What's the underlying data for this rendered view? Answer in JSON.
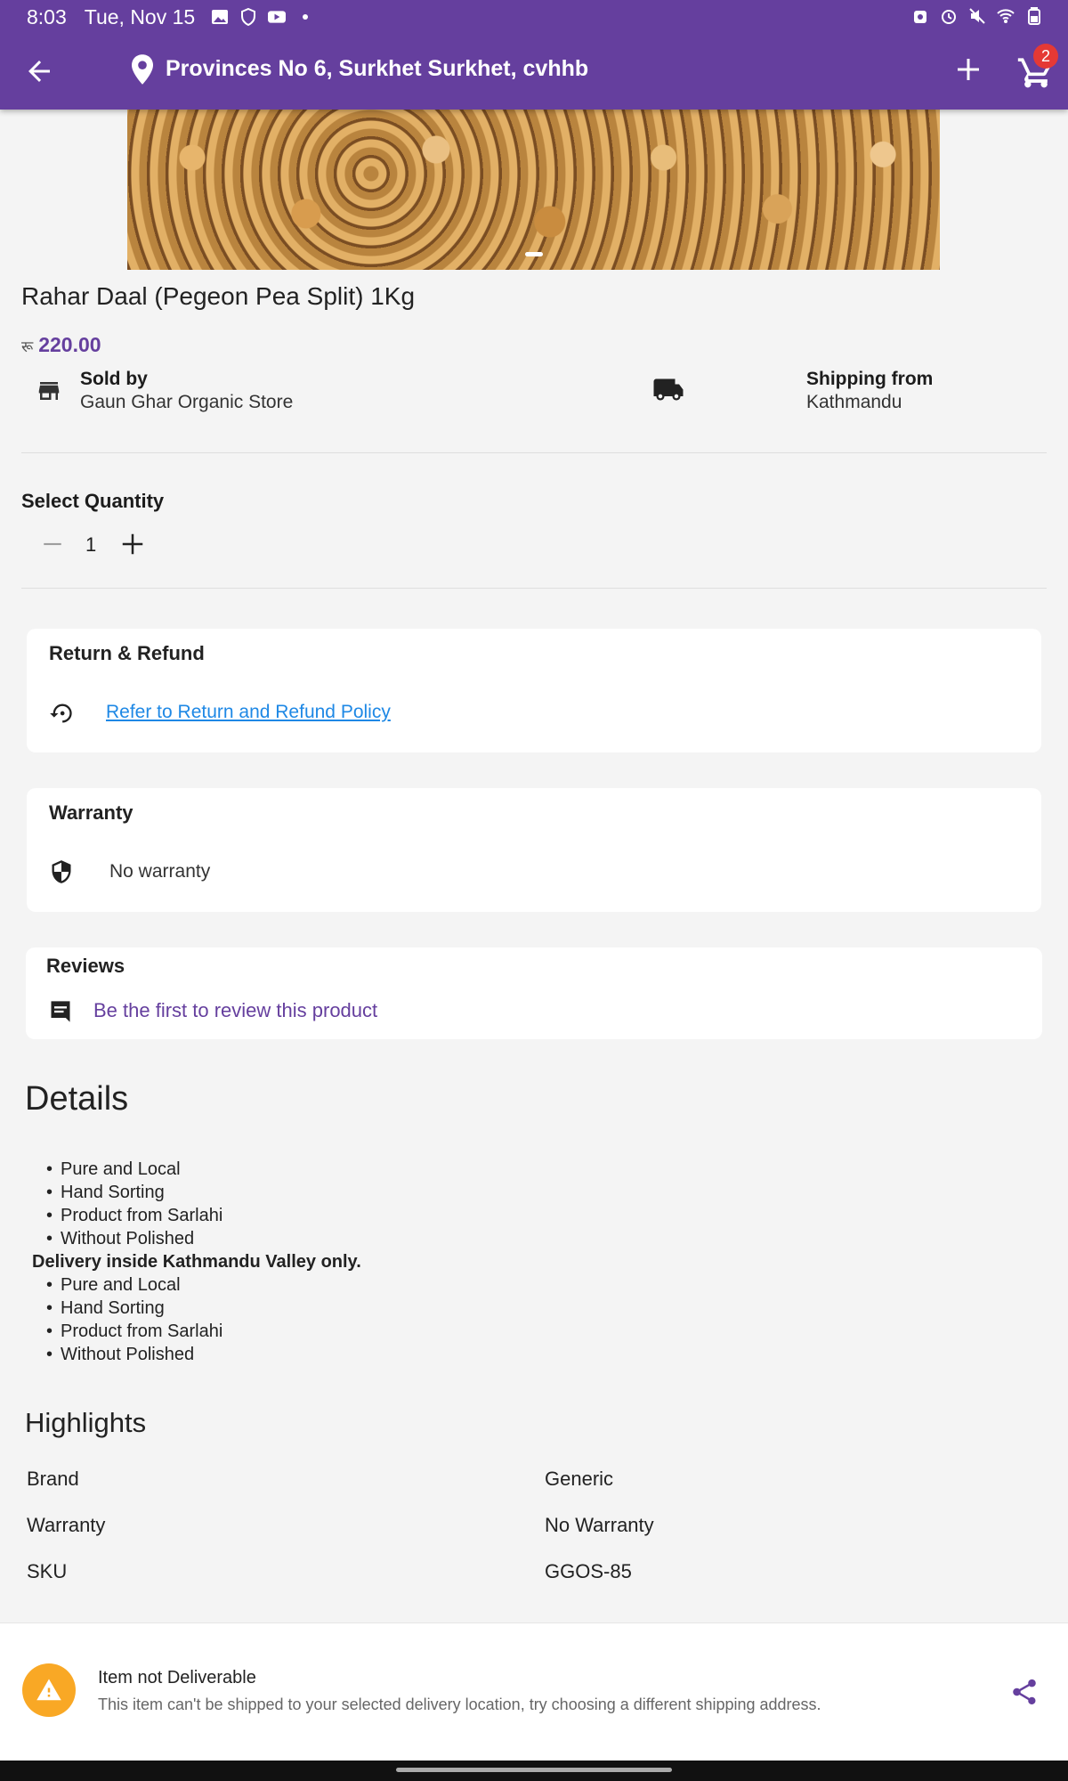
{
  "status_bar": {
    "time": "8:03",
    "date": "Tue, Nov 15"
  },
  "header": {
    "location": "Provinces No 6,  Surkhet Surkhet, cvhhb",
    "cart_count": "2",
    "accent_color": "#653f9e"
  },
  "product": {
    "title": "Rahar Daal (Pegeon Pea Split) 1Kg",
    "currency_symbol": "रू",
    "price": "220.00",
    "sold_by_label": "Sold by",
    "sold_by_value": "Gaun Ghar Organic Store",
    "shipping_label": "Shipping from",
    "shipping_value": "Kathmandu"
  },
  "quantity": {
    "label": "Select Quantity",
    "value": "1"
  },
  "return_refund": {
    "title": "Return & Refund",
    "link_text": "Refer to Return and Refund Policy"
  },
  "warranty": {
    "title": "Warranty",
    "text": "No warranty"
  },
  "reviews": {
    "title": "Reviews",
    "link_text": "Be the first to review this product"
  },
  "details": {
    "heading": "Details",
    "list1": [
      "Pure and Local",
      "Hand Sorting",
      "Product from Sarlahi",
      "Without Polished"
    ],
    "bold_line": "Delivery inside Kathmandu Valley only.",
    "list2": [
      "Pure and Local",
      "Hand Sorting",
      "Product from Sarlahi",
      "Without Polished"
    ]
  },
  "highlights": {
    "heading": "Highlights",
    "rows": [
      {
        "key": "Brand",
        "value": "Generic"
      },
      {
        "key": "Warranty",
        "value": "No Warranty"
      },
      {
        "key": "SKU",
        "value": "GGOS-85"
      }
    ]
  },
  "banner": {
    "title": "Item not Deliverable",
    "text": "This item can't be shipped to your selected delivery location, try choosing a different shipping address."
  }
}
